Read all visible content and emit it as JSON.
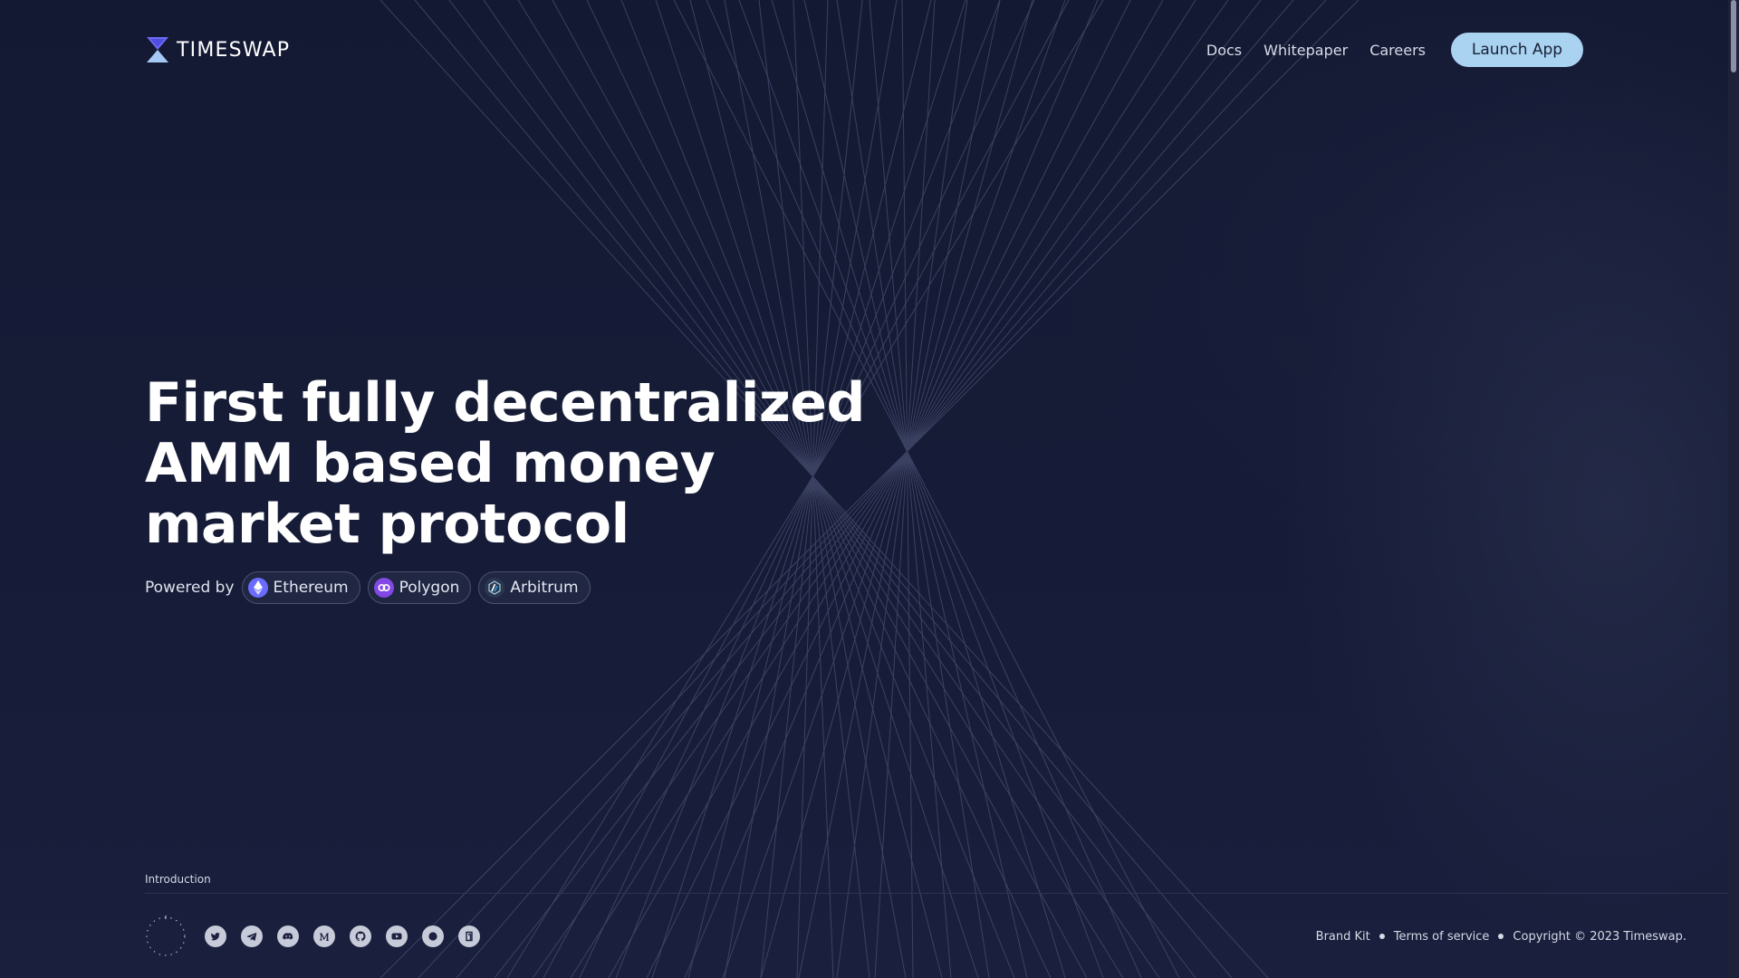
{
  "brand": {
    "name": "TIMESWAP"
  },
  "nav": {
    "links": [
      "Docs",
      "Whitepaper",
      "Careers"
    ],
    "cta": "Launch App"
  },
  "hero": {
    "headline_lines": [
      "First fully decentralized",
      "AMM based money",
      "market protocol"
    ],
    "powered_by_label": "Powered by",
    "chains": [
      {
        "label": "Ethereum",
        "icon": "ethereum-icon",
        "color": "#6b6bff"
      },
      {
        "label": "Polygon",
        "icon": "polygon-icon",
        "color": "#8247e5"
      },
      {
        "label": "Arbitrum",
        "icon": "arbitrum-icon",
        "color": "#28a0f0"
      }
    ]
  },
  "section": {
    "label": "Introduction"
  },
  "footer": {
    "socials": [
      "twitter-icon",
      "telegram-icon",
      "discord-icon",
      "medium-icon",
      "github-icon",
      "youtube-icon",
      "mirror-icon",
      "gitbook-icon"
    ],
    "links": [
      "Brand Kit",
      "Terms of service",
      "Copyright © 2023 Timeswap."
    ]
  },
  "colors": {
    "background": "#151a33",
    "accent": "#a9d3f0",
    "text": "#ffffff"
  }
}
